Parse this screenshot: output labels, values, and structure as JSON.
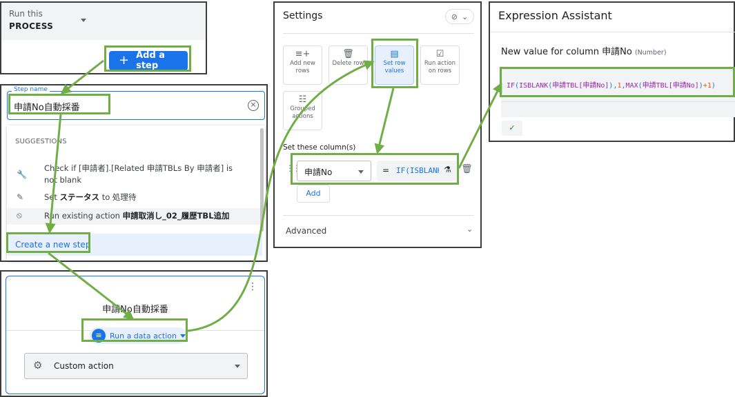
{
  "process_panel": {
    "run_label": "Run this",
    "process_value": "PROCESS",
    "add_step_label": "Add a step",
    "add_step_icon": "plus-icon"
  },
  "step_panel": {
    "field_label": "Step name",
    "field_value": "申請No自動採番",
    "suggestions_title": "SUGGESTIONS",
    "suggestions": [
      {
        "icon": "wrench-icon",
        "text_before": "Check if [申請者].[Related 申請TBLs By 申請者] is not blank",
        "bold": "",
        "text_after": ""
      },
      {
        "icon": "edit-icon",
        "text_before": "Set ",
        "bold": "ステータス",
        "text_after": " to 処理待"
      },
      {
        "icon": "block-icon",
        "text_before": "Run existing action ",
        "bold": "申請取消し_02_履歴TBL追加",
        "text_after": ""
      }
    ],
    "create_label": "Create a new step"
  },
  "step_card": {
    "title": "申請No自動採番",
    "action_label": "Run a data action",
    "type_label": "Custom action"
  },
  "settings": {
    "title": "Settings",
    "action_tiles": [
      {
        "label": "Add new rows",
        "icon": "add-rows-icon",
        "selected": false
      },
      {
        "label": "Delete row",
        "icon": "trash-icon",
        "selected": false
      },
      {
        "label": "Set row values",
        "icon": "form-icon",
        "selected": true
      },
      {
        "label": "Run action on rows",
        "icon": "checklist-icon",
        "selected": false
      },
      {
        "label": "Grouped actions",
        "icon": "grouped-icon",
        "selected": false
      }
    ],
    "set_columns_label": "Set these column(s)",
    "column_value": "申請No",
    "equals": "=",
    "expression_preview": "IF(ISBLANK(",
    "add_label": "Add",
    "advanced_label": "Advanced"
  },
  "expression_assistant": {
    "title": "Expression Assistant",
    "new_value_label": "New value for column 申請No",
    "type_hint": "(Number)",
    "expression": "IF(ISBLANK(申請TBL[申請No]),1,MAX(申請TBL[申請No])+1)"
  },
  "colors": {
    "highlight": "#70ad47",
    "primary": "#1a73e8"
  }
}
